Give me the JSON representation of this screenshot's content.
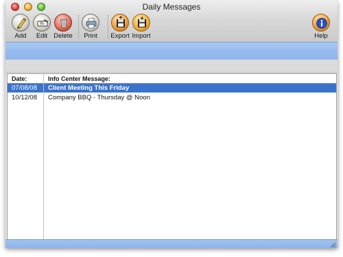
{
  "window": {
    "title": "Daily Messages"
  },
  "toolbar": {
    "add": "Add",
    "edit": "Edit",
    "delete": "Delete",
    "print": "Print",
    "export": "Export",
    "import": "Import",
    "help": "Help"
  },
  "icons": {
    "add": "pencil-icon",
    "edit": "edit-hand-icon",
    "delete": "trash-icon",
    "print": "printer-icon",
    "export": "export-disk-icon",
    "import": "import-disk-icon",
    "help": "info-icon"
  },
  "colors": {
    "selection": "#3a73cc",
    "band": "#97bcef"
  },
  "table": {
    "headers": {
      "date": "Date:",
      "message": "Info Center Message:"
    },
    "rows": [
      {
        "date": "07/08/08",
        "message": "Client Meeting This Friday",
        "selected": true
      },
      {
        "date": "10/12/08",
        "message": "Company BBQ - Thursday @ Noon",
        "selected": false
      }
    ]
  }
}
